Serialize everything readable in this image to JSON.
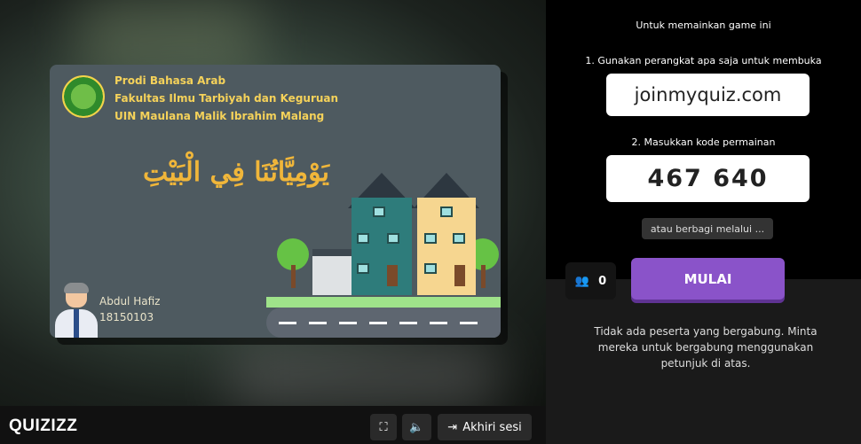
{
  "slide": {
    "institution_lines": [
      "Prodi Bahasa Arab",
      "Fakultas Ilmu Tarbiyah dan Keguruan",
      "UIN Maulana Malik Ibrahim Malang"
    ],
    "arabic_title": "يَوْمِيَّاتُنَا فِي الْبَيْتِ",
    "author_name": "Abdul Hafiz",
    "author_id": "18150103"
  },
  "bottom_bar": {
    "brand": "QUIZIZZ",
    "fullscreen_icon": "fullscreen-icon",
    "sound_icon": "speaker-icon",
    "end_session_icon": "exit-icon",
    "end_session_label": "Akhiri sesi"
  },
  "join_panel": {
    "heading": "Untuk memainkan game ini",
    "step1": "1. Gunakan perangkat apa saja untuk membuka",
    "join_url": "joinmyquiz.com",
    "step2": "2. Masukkan kode permainan",
    "game_code": "467 640",
    "share_label": "atau berbagi melalui ...",
    "participants_icon": "users-icon",
    "participant_count": "0",
    "start_button": "MULAI",
    "no_participants_message": "Tidak ada peserta yang bergabung. Minta mereka untuk bergabung menggunakan petunjuk di atas."
  },
  "colors": {
    "start_button": "#8a53c9",
    "slide_title": "#f0b63a",
    "institution_text": "#f5d25a"
  }
}
